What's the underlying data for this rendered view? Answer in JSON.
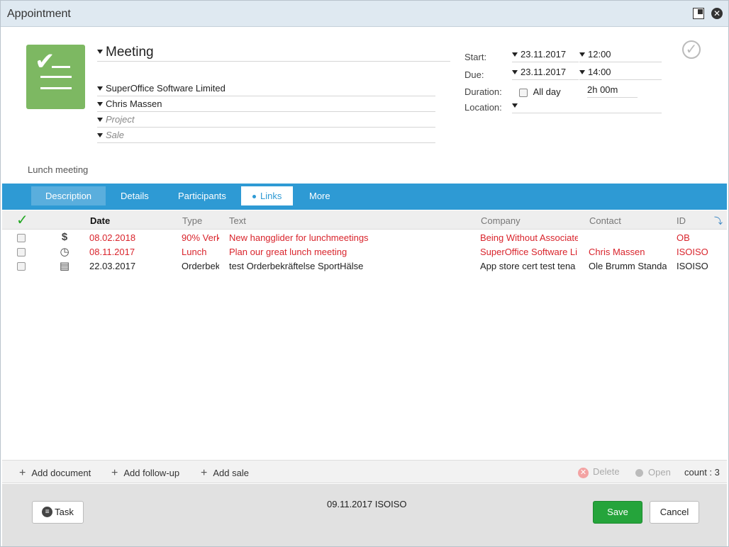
{
  "window": {
    "title": "Appointment"
  },
  "header": {
    "title": "Meeting",
    "company": "SuperOffice Software Limited",
    "contact": "Chris Massen",
    "project_placeholder": "Project",
    "sale_placeholder": "Sale",
    "description": "Lunch meeting"
  },
  "schedule": {
    "start_label": "Start:",
    "start_date": "23.11.2017",
    "start_time": "12:00",
    "due_label": "Due:",
    "due_date": "23.11.2017",
    "due_time": "14:00",
    "duration_label": "Duration:",
    "allday_label": "All day",
    "allday_checked": false,
    "duration_value": "2h 00m",
    "location_label": "Location:",
    "location_value": ""
  },
  "tabs": [
    {
      "label": "Description",
      "active": false
    },
    {
      "label": "Details",
      "active": false
    },
    {
      "label": "Participants",
      "active": false
    },
    {
      "label": "Links",
      "active": true
    },
    {
      "label": "More",
      "active": false
    }
  ],
  "table": {
    "columns": [
      "Date",
      "Type",
      "Text",
      "Company",
      "Contact",
      "ID"
    ],
    "rows": [
      {
        "icon": "dollar-icon",
        "date": "08.02.2018",
        "type": "90% Verk",
        "text": "New hangglider for lunchmeetings",
        "company": "Being Without Associate",
        "contact": "",
        "id": "OB",
        "highlight": true
      },
      {
        "icon": "clock-icon",
        "date": "08.11.2017",
        "type": "Lunch",
        "text": "Plan our great lunch meeting",
        "company": "SuperOffice Software Li",
        "contact": "Chris Massen",
        "id": "ISOISO",
        "highlight": true
      },
      {
        "icon": "document-icon",
        "date": "22.03.2017",
        "type": "Orderbek",
        "text": "test Orderbekräftelse SportHälse",
        "company": "App store cert test tena",
        "contact": "Ole Brumm Standa",
        "id": "ISOISO",
        "highlight": false
      }
    ]
  },
  "actions": {
    "add_document": "Add document",
    "add_followup": "Add follow-up",
    "add_sale": "Add sale",
    "delete": "Delete",
    "open": "Open",
    "count": "count : 3"
  },
  "footer": {
    "task_label": "Task",
    "info": "09.11.2017 ISOISO",
    "save_label": "Save",
    "cancel_label": "Cancel"
  },
  "colors": {
    "accent": "#2e9ad4",
    "highlight_text": "#d9242c",
    "save": "#25a43b",
    "icon_green": "#7db862"
  }
}
